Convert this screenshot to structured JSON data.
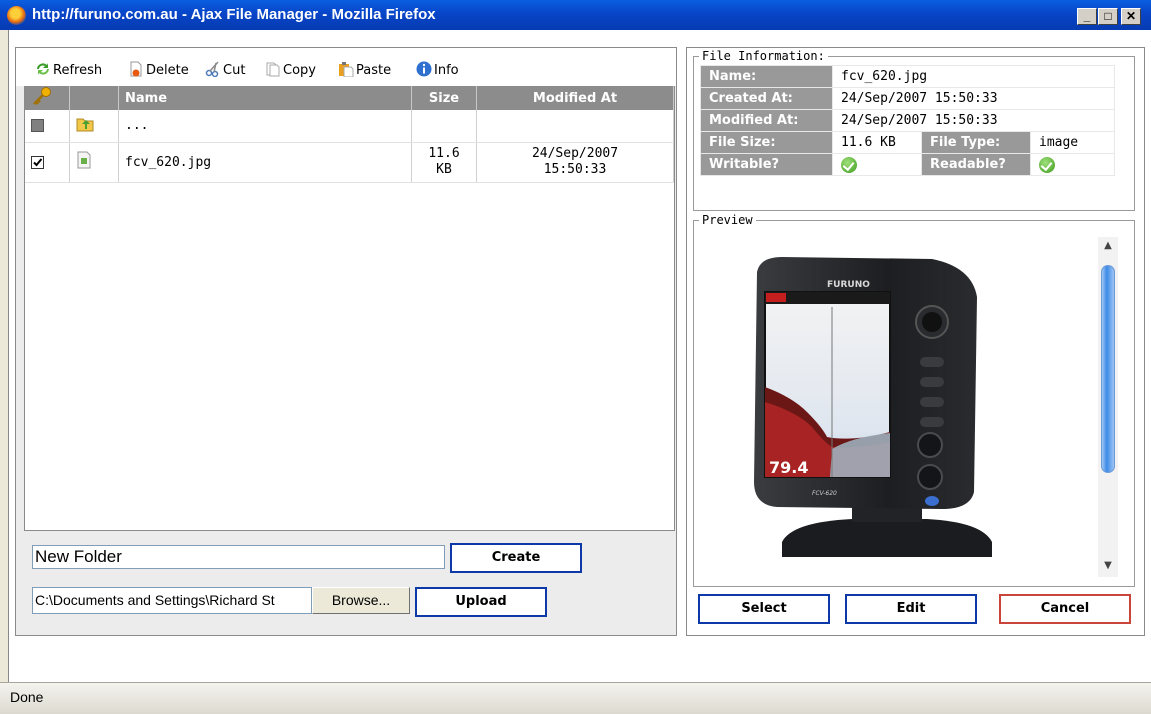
{
  "window": {
    "title": "http://furuno.com.au - Ajax File Manager - Mozilla Firefox"
  },
  "toolbar": {
    "refresh": "Refresh",
    "delete": "Delete",
    "cut": "Cut",
    "copy": "Copy",
    "paste": "Paste",
    "info": "Info"
  },
  "file_table": {
    "headers": {
      "name": "Name",
      "size": "Size",
      "modified": "Modified At"
    },
    "rows": [
      {
        "checked": false,
        "icon": "folder-up-icon",
        "name": "...",
        "size": "",
        "modified": ""
      },
      {
        "checked": true,
        "icon": "image-file-icon",
        "name": "fcv_620.jpg",
        "size_line1": "11.6",
        "size_line2": "KB",
        "modified_line1": "24/Sep/2007",
        "modified_line2": "15:50:33"
      }
    ]
  },
  "new_folder": {
    "value": "New Folder",
    "create_label": "Create"
  },
  "upload": {
    "path": "C:\\Documents and Settings\\Richard St",
    "browse_label": "Browse...",
    "upload_label": "Upload"
  },
  "file_info": {
    "legend": "File Information:",
    "name_label": "Name:",
    "name": "fcv_620.jpg",
    "created_label": "Created At:",
    "created": "24/Sep/2007 15:50:33",
    "modified_label": "Modified At:",
    "modified": "24/Sep/2007 15:50:33",
    "size_label": "File Size:",
    "size": "11.6 KB",
    "type_label": "File Type:",
    "type": "image",
    "writable_label": "Writable?",
    "readable_label": "Readable?"
  },
  "preview": {
    "legend": "Preview",
    "device_brand": "FURUNO",
    "device_model": "FCV-620",
    "screen_reading": "79.4"
  },
  "actions": {
    "select": "Select",
    "edit": "Edit",
    "cancel": "Cancel"
  },
  "status": {
    "text": "Done"
  },
  "colors": {
    "title_bar": "#0845c8",
    "button_border": "#0c38a8",
    "cancel_border": "#c9453a",
    "header_gray": "#8c8c8c"
  }
}
